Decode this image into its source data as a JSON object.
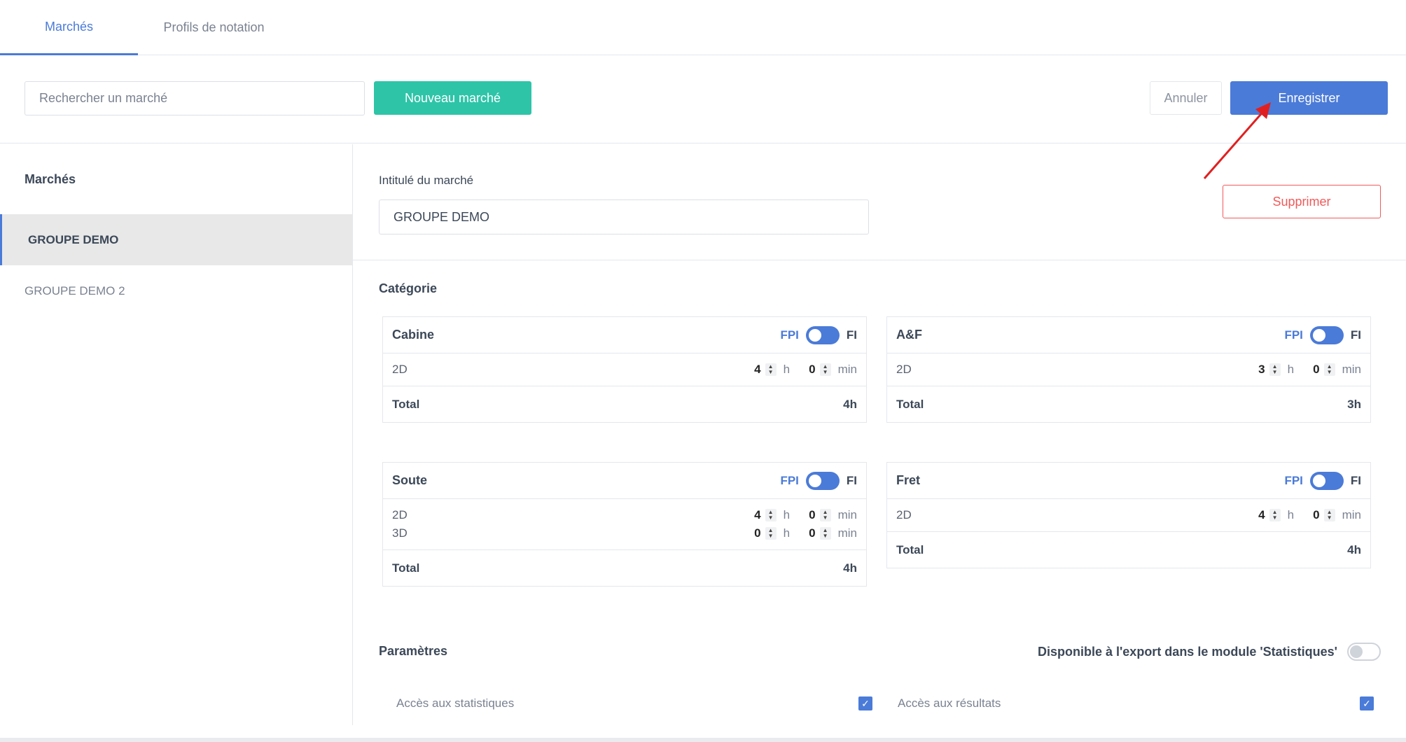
{
  "tabs": [
    {
      "label": "Marchés",
      "active": true
    },
    {
      "label": "Profils de notation",
      "active": false
    }
  ],
  "toolbar": {
    "search_placeholder": "Rechercher un marché",
    "new_label": "Nouveau marché",
    "cancel_label": "Annuler",
    "save_label": "Enregistrer"
  },
  "sidebar": {
    "title": "Marchés",
    "items": [
      {
        "label": "GROUPE DEMO",
        "active": true
      },
      {
        "label": "GROUPE DEMO 2",
        "active": false
      }
    ]
  },
  "main": {
    "intitule_label": "Intitulé du marché",
    "intitule_value": "GROUPE DEMO",
    "delete_label": "Supprimer",
    "categorie_title": "Catégorie",
    "toggle_left": "FPI",
    "toggle_right": "FI",
    "hours_unit": "h",
    "minutes_unit": "min",
    "total_label": "Total",
    "cards": [
      {
        "name": "Cabine",
        "rows": [
          {
            "label": "2D",
            "h": "4",
            "m": "0"
          }
        ],
        "total": "4h"
      },
      {
        "name": "A&F",
        "rows": [
          {
            "label": "2D",
            "h": "3",
            "m": "0"
          }
        ],
        "total": "3h"
      },
      {
        "name": "Soute",
        "rows": [
          {
            "label": "2D",
            "h": "4",
            "m": "0"
          },
          {
            "label": "3D",
            "h": "0",
            "m": "0"
          }
        ],
        "total": "4h"
      },
      {
        "name": "Fret",
        "rows": [
          {
            "label": "2D",
            "h": "4",
            "m": "0"
          }
        ],
        "total": "4h"
      }
    ],
    "parametres_title": "Paramètres",
    "export_label": "Disponible à l'export dans le module 'Statistiques'",
    "acces_stats": "Accès aux statistiques",
    "acces_resultats": "Accès aux résultats"
  },
  "colors": {
    "accent": "#4b7bd8",
    "new_button": "#2ec4a8",
    "danger": "#f05a5a",
    "annotation": "#e02020"
  }
}
